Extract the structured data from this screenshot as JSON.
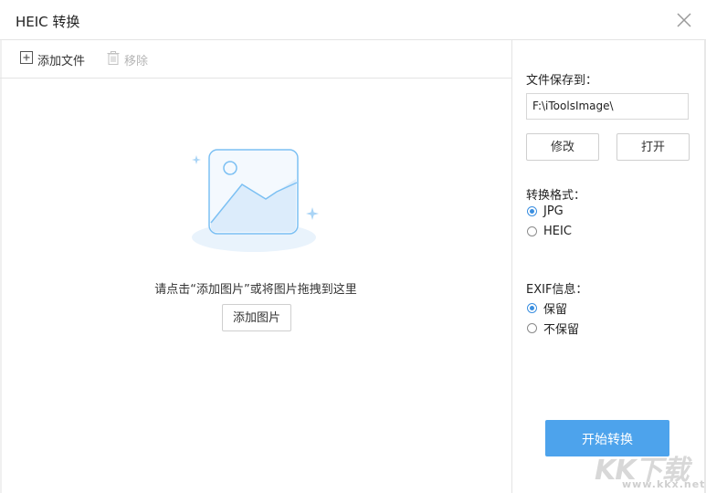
{
  "window": {
    "title": "HEIC 转换"
  },
  "toolbar": {
    "add_file": "添加文件",
    "remove": "移除"
  },
  "drop_area": {
    "hint": "请点击“添加图片”或将图片拖拽到这里",
    "add_image_button": "添加图片"
  },
  "save_panel": {
    "label": "文件保存到：",
    "path": "F:\\iToolsImage\\",
    "modify_button": "修改",
    "open_button": "打开"
  },
  "format": {
    "label": "转换格式：",
    "options": [
      {
        "label": "JPG",
        "checked": true
      },
      {
        "label": "HEIC",
        "checked": false
      }
    ]
  },
  "exif": {
    "label": "EXIF信息：",
    "options": [
      {
        "label": "保留",
        "checked": true
      },
      {
        "label": "不保留",
        "checked": false
      }
    ]
  },
  "start_button": "开始转换",
  "watermark": {
    "text": "KK下载",
    "url": "www.kkx.net"
  },
  "colors": {
    "accent": "#4da3ec",
    "border": "#e4e4e4",
    "illustration": "#7cc0f3"
  }
}
